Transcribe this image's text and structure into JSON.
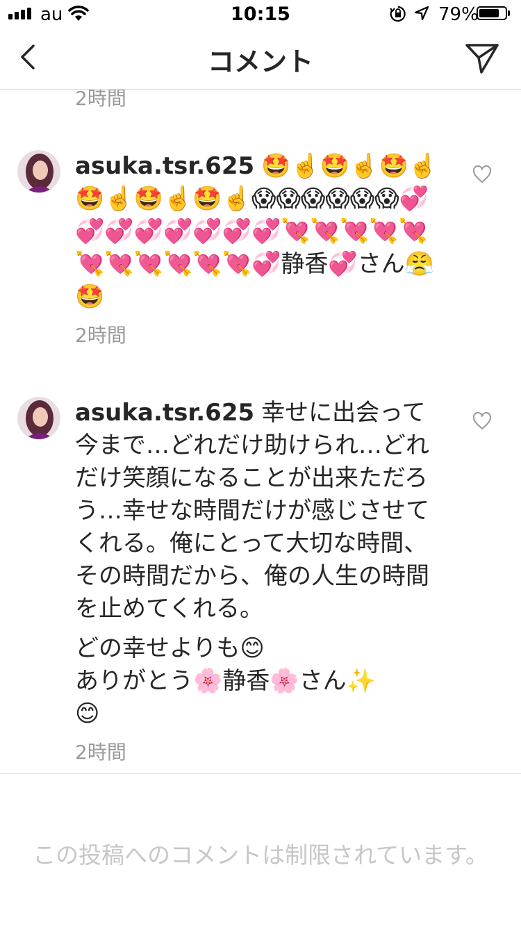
{
  "status_bar": {
    "carrier": "au",
    "time": "10:15",
    "battery_percent": "79%",
    "battery_level": 0.79
  },
  "nav": {
    "title": "コメント",
    "back_icon": "chevron-left-icon",
    "send_icon": "paper-plane-icon"
  },
  "top_timestamp": "2時間",
  "comments": [
    {
      "username": "asuka.tsr.625",
      "paragraphs": [
        "🤩☝️🤩☝️🤩☝️🤩☝️🤩☝️🤩☝️😱😱😱😱😱😱💞💞💞💞💞💞💞💞💘💘💘💘💘💘💘💘💘💘💘💞静香💞さん😤🤩"
      ],
      "time": "2時間"
    },
    {
      "username": "asuka.tsr.625",
      "paragraphs": [
        "幸せに出会って今まで…どれだけ助けられ…どれだけ笑顔になることが出来ただろう…幸せな時間だけが感じさせてくれる。俺にとって大切な時間、その時間だから、俺の人生の時間を止めてくれる。",
        "どの幸せよりも😊",
        "ありがとう🌸静香🌸さん✨",
        "😊"
      ],
      "time": "2時間"
    }
  ],
  "footer_note": "この投稿へのコメントは制限されています。",
  "colors": {
    "text": "#262626",
    "secondary_text": "#999999",
    "divider": "#dbdbdb",
    "disabled_text": "#c7c7c7"
  }
}
